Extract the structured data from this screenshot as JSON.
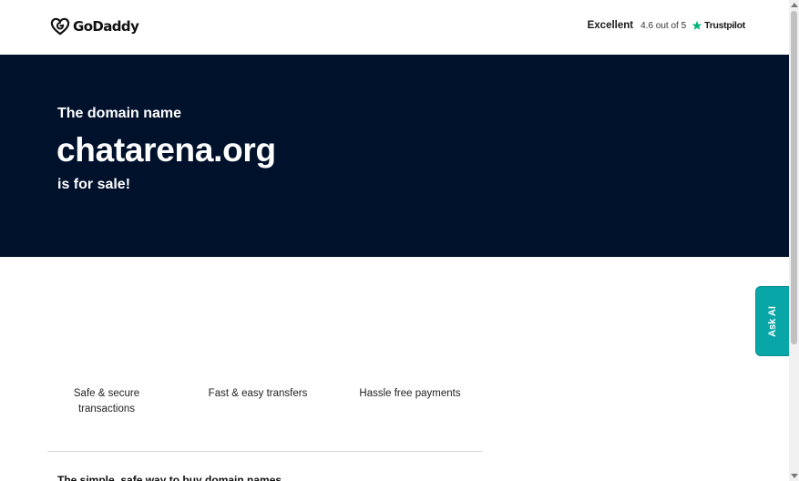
{
  "header": {
    "logo_text": "GoDaddy",
    "logo_icon": "godaddy-logo-icon",
    "trustpilot": {
      "label": "Excellent",
      "score": "4.6 out of 5",
      "brand": "Trustpilot",
      "star_icon": "star-icon",
      "star_color": "#00b67a"
    }
  },
  "hero": {
    "eyebrow": "The domain name",
    "domain": "chatarena.org",
    "sale_text": "is for sale!",
    "background_color": "#00112c"
  },
  "features": [
    {
      "label": "Safe & secure transactions"
    },
    {
      "label": "Fast & easy transfers"
    },
    {
      "label": "Hassle free payments"
    }
  ],
  "section": {
    "subheading": "The simple, safe way to buy domain names"
  },
  "ask_ai": {
    "label": "Ask AI",
    "color": "#09a6a8"
  },
  "scrollbar": {
    "up_icon": "scroll-up-arrow-icon",
    "down_icon": "scroll-down-arrow-icon"
  }
}
